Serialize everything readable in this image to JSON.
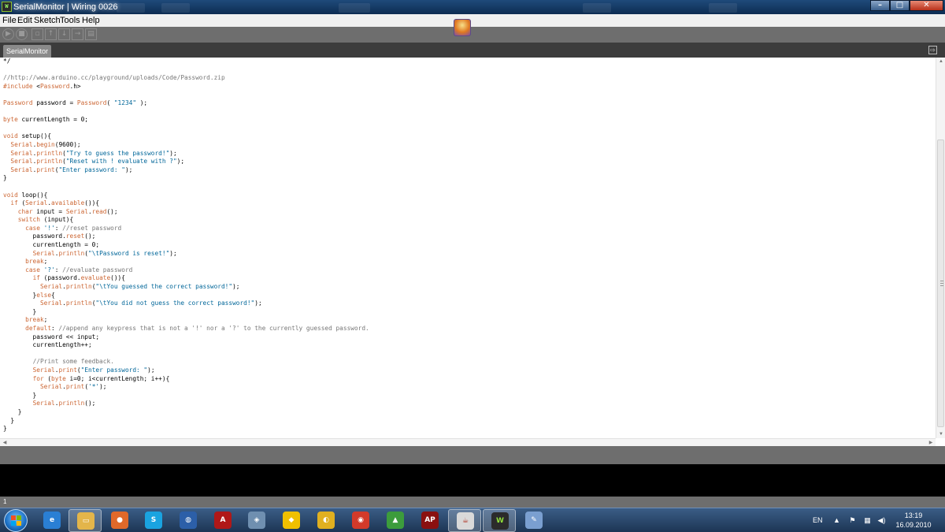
{
  "window": {
    "title": "SerialMonitor | Wiring 0026",
    "app_icon": "wiring-app-icon",
    "controls": {
      "minimize": "–",
      "maximize": "□",
      "close": "✕"
    }
  },
  "menu": {
    "items": [
      "File",
      "Edit",
      "Sketch",
      "Tools",
      "Help"
    ]
  },
  "toolbar": {
    "buttons": [
      {
        "name": "verify-button",
        "icon": "play-icon",
        "glyph": "▶"
      },
      {
        "name": "stop-button",
        "icon": "stop-icon",
        "glyph": "■"
      },
      {
        "name": "new-button",
        "icon": "new-file-icon",
        "glyph": "▫"
      },
      {
        "name": "open-button",
        "icon": "open-icon",
        "glyph": "↑"
      },
      {
        "name": "save-button",
        "icon": "save-icon",
        "glyph": "↓"
      },
      {
        "name": "upload-button",
        "icon": "upload-icon",
        "glyph": "→"
      },
      {
        "name": "serial-monitor-button",
        "icon": "serial-monitor-icon",
        "glyph": "▤"
      }
    ]
  },
  "tabs": [
    {
      "label": "SerialMonitor"
    }
  ],
  "editor": {
    "lines": [
      "*/",
      "",
      "//http://www.arduino.cc/playground/uploads/Code/Password.zip",
      "#include <Password.h>",
      "",
      "Password password = Password( \"1234\" );",
      "",
      "byte currentLength = 0;",
      "",
      "void setup(){",
      "  Serial.begin(9600);",
      "  Serial.println(\"Try to guess the password!\");",
      "  Serial.println(\"Reset with ! evaluate with ?\");",
      "  Serial.print(\"Enter password: \");",
      "}",
      "",
      "void loop(){",
      "  if (Serial.available()){",
      "    char input = Serial.read();",
      "    switch (input){",
      "      case '!': //reset password",
      "        password.reset();",
      "        currentLength = 0;",
      "        Serial.println(\"\\tPassword is reset!\");",
      "      break;",
      "      case '?': //evaluate password",
      "        if (password.evaluate()){",
      "          Serial.println(\"\\tYou guessed the correct password!\");",
      "        }else{",
      "          Serial.println(\"\\tYou did not guess the correct password!\");",
      "        }",
      "      break;",
      "      default: //append any keypress that is not a '!' nor a '?' to the currently guessed password.",
      "        password << input;",
      "        currentLength++;",
      "",
      "        //Print some feedback.",
      "        Serial.print(\"Enter password: \");",
      "        for (byte i=0; i<currentLength; i++){",
      "          Serial.print('*');",
      "        }",
      "        Serial.println();",
      "    }",
      "  }",
      "}"
    ]
  },
  "status": {
    "line_number": "1"
  },
  "taskbar": {
    "apps": [
      {
        "name": "internet-explorer",
        "icon": "ie-icon",
        "glyph": "e",
        "color": "#2a7fd4",
        "active": false
      },
      {
        "name": "windows-explorer",
        "icon": "folder-icon",
        "glyph": "▭",
        "color": "#e3b54a",
        "active": true
      },
      {
        "name": "firefox",
        "icon": "firefox-icon",
        "glyph": "●",
        "color": "#e0692a",
        "active": false
      },
      {
        "name": "skype",
        "icon": "skype-icon",
        "glyph": "S",
        "color": "#1aa3e0",
        "active": false
      },
      {
        "name": "google-earth",
        "icon": "globe-icon",
        "glyph": "◍",
        "color": "#2c5fa8",
        "active": false
      },
      {
        "name": "acrobat",
        "icon": "acrobat-icon",
        "glyph": "A",
        "color": "#b01818",
        "active": false
      },
      {
        "name": "network-tool",
        "icon": "network-icon",
        "glyph": "◈",
        "color": "#6f8fb0",
        "active": false
      },
      {
        "name": "batman-app",
        "icon": "bat-icon",
        "glyph": "◆",
        "color": "#f0c000",
        "active": false
      },
      {
        "name": "feed-app",
        "icon": "feed-icon",
        "glyph": "◐",
        "color": "#e0b020",
        "active": false
      },
      {
        "name": "chrome",
        "icon": "chrome-icon",
        "glyph": "◉",
        "color": "#d23a2a",
        "active": false
      },
      {
        "name": "android-tool",
        "icon": "android-icon",
        "glyph": "▲",
        "color": "#3c9c3c",
        "active": false
      },
      {
        "name": "ap-app",
        "icon": "ap-icon",
        "glyph": "AP",
        "color": "#8a1010",
        "active": false
      },
      {
        "name": "java",
        "icon": "java-icon",
        "glyph": "☕",
        "color": "#d9d9d9",
        "active": true
      },
      {
        "name": "wiring",
        "icon": "wiring-app-icon",
        "glyph": "W",
        "color": "#2b2b2b",
        "active": true
      },
      {
        "name": "paint",
        "icon": "paint-icon",
        "glyph": "✎",
        "color": "#7a9fd0",
        "active": false
      }
    ],
    "tray": {
      "language": "EN",
      "icons": [
        "chevron-up-icon",
        "flag-icon",
        "network-icon",
        "volume-icon"
      ],
      "time": "13:19",
      "date": "16.09.2010"
    }
  },
  "colors": {
    "keyword": "#cc6633",
    "class": "#cc6633",
    "method": "#cc6633",
    "string": "#006699",
    "comment": "#777777"
  }
}
